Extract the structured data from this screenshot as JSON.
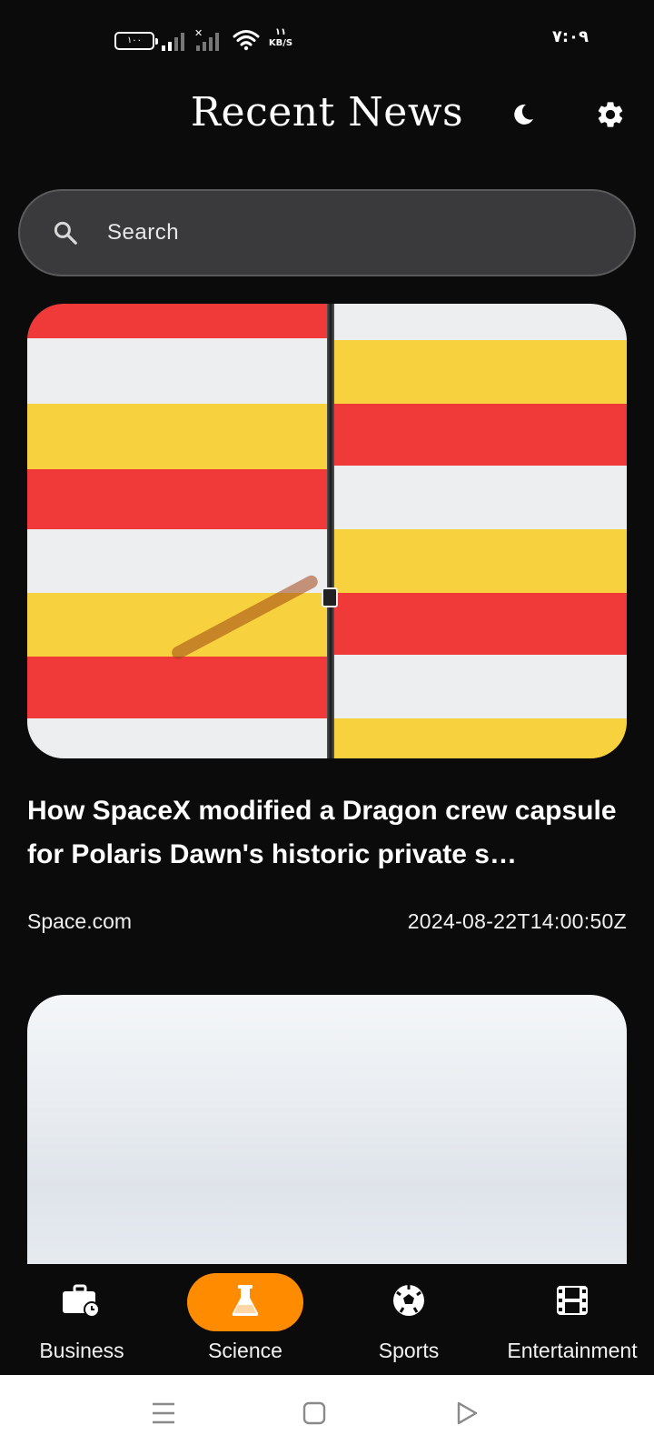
{
  "status_bar": {
    "battery": "١٠٠",
    "network_speed_value": "١١",
    "network_speed_unit": "KB/S",
    "time": "٧:٠٩"
  },
  "header": {
    "title": "Recent News",
    "icons": [
      "moon-icon",
      "gear-icon"
    ]
  },
  "search": {
    "placeholder": "Search",
    "value": ""
  },
  "articles": [
    {
      "title": "How SpaceX modified a Dragon crew capsule for Polaris Dawn's historic private s…",
      "source": "Space.com",
      "published": "2024-08-22T14:00:50Z",
      "image": "striped-panels-photo"
    },
    {
      "title": "",
      "source": "",
      "published": "",
      "image": "overcast-sky-photo"
    }
  ],
  "bottom_nav": {
    "accent": "#ff8c00",
    "items": [
      {
        "label": "Business",
        "icon": "briefcase-clock-icon",
        "active": false
      },
      {
        "label": "Science",
        "icon": "flask-icon",
        "active": true
      },
      {
        "label": "Sports",
        "icon": "soccer-ball-icon",
        "active": false
      },
      {
        "label": "Entertainment",
        "icon": "film-icon",
        "active": false
      }
    ]
  },
  "system_nav": {
    "icons": [
      "menu-icon",
      "home-icon",
      "back-icon"
    ]
  }
}
